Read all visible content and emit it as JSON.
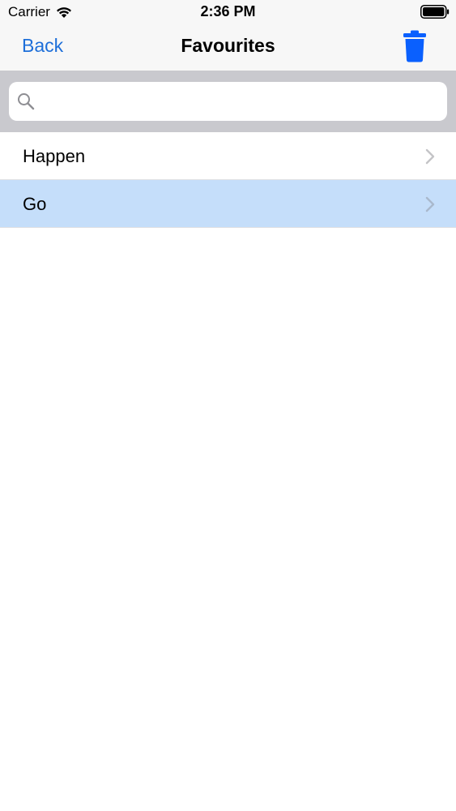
{
  "status_bar": {
    "carrier": "Carrier",
    "time": "2:36 PM",
    "icons": [
      "wifi-icon",
      "battery-icon"
    ]
  },
  "nav_bar": {
    "back_label": "Back",
    "title": "Favourites",
    "trash_icon": "trash-icon"
  },
  "search": {
    "placeholder": "",
    "value": "",
    "icon": "search-icon"
  },
  "list": {
    "items": [
      {
        "label": "Happen",
        "selected": false
      },
      {
        "label": "Go",
        "selected": true
      }
    ]
  },
  "colors": {
    "accent": "#1e6fd9",
    "trash": "#0a60fe",
    "nav_background": "#f7f7f7",
    "search_bar_background": "#c9c9ce",
    "selected_row": "#c5defa",
    "chevron": "#c4c4c7"
  }
}
